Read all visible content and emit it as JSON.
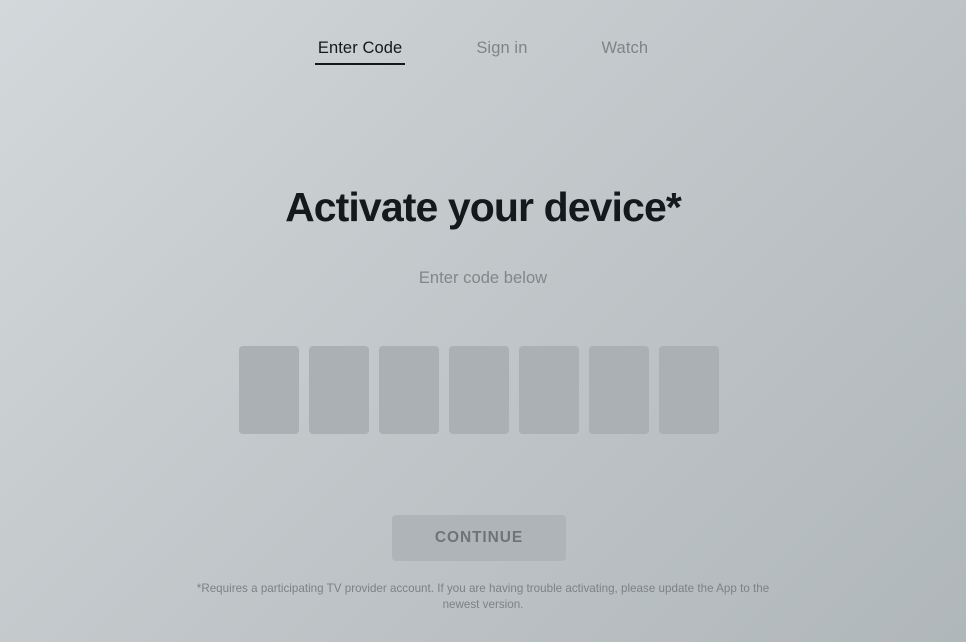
{
  "nav": {
    "items": [
      {
        "label": "Enter Code",
        "active": true
      },
      {
        "label": "Sign in",
        "active": false
      },
      {
        "label": "Watch",
        "active": false
      }
    ]
  },
  "hero": {
    "headline": "Activate your device*",
    "subhead": "Enter code below"
  },
  "code_entry": {
    "boxes": [
      {
        "value": ""
      },
      {
        "value": ""
      },
      {
        "value": ""
      },
      {
        "value": ""
      },
      {
        "value": ""
      },
      {
        "value": ""
      },
      {
        "value": ""
      }
    ],
    "box_count": 7
  },
  "actions": {
    "continue_label": "CONTINUE"
  },
  "footer": {
    "disclaimer": "*Requires a participating TV provider account. If you are having trouble activating, please update the App to the newest version."
  },
  "colors": {
    "background_start": "#d3d8db",
    "background_end": "#b0b7ba",
    "active_nav": "#14181a",
    "inactive_nav": "#7d8588",
    "headline": "#16191b",
    "muted_text": "#808789",
    "code_box_fill": "#aab0b4",
    "button_fill": "#aeb4b7",
    "button_text": "#6e7578"
  }
}
